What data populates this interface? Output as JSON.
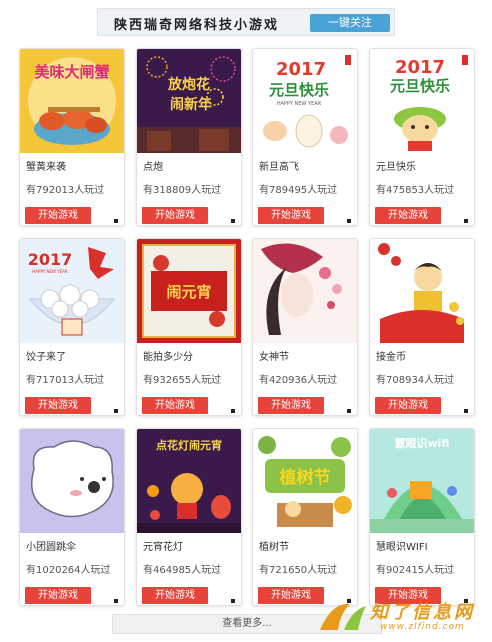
{
  "header": {
    "title": "陕西瑞奇网络科技小游戏",
    "follow_label": "一键关注"
  },
  "games": [
    {
      "name": "蟹黄来袭",
      "plays": "有792013人玩过",
      "start_label": "开始游戏",
      "thumb": "crab"
    },
    {
      "name": "点炮",
      "plays": "有318809人玩过",
      "start_label": "开始游戏",
      "thumb": "firecracker"
    },
    {
      "name": "新旦高飞",
      "plays": "有789495人玩过",
      "start_label": "开始游戏",
      "thumb": "newyear-egg"
    },
    {
      "name": "元旦快乐",
      "plays": "有475853人玩过",
      "start_label": "开始游戏",
      "thumb": "newyear-character"
    },
    {
      "name": "饺子来了",
      "plays": "有717013人玩过",
      "start_label": "开始游戏",
      "thumb": "dumplings"
    },
    {
      "name": "能拍多少分",
      "plays": "有932655人玩过",
      "start_label": "开始游戏",
      "thumb": "red-festival"
    },
    {
      "name": "女神节",
      "plays": "有420936人玩过",
      "start_label": "开始游戏",
      "thumb": "goddess"
    },
    {
      "name": "接金币",
      "plays": "有708934人玩过",
      "start_label": "开始游戏",
      "thumb": "coins"
    },
    {
      "name": "小团圆跳伞",
      "plays": "有1020264人玩过",
      "start_label": "开始游戏",
      "thumb": "bear"
    },
    {
      "name": "元宵花灯",
      "plays": "有464985人玩过",
      "start_label": "开始游戏",
      "thumb": "lantern"
    },
    {
      "name": "植树节",
      "plays": "有721650人玩过",
      "start_label": "开始游戏",
      "thumb": "tree"
    },
    {
      "name": "慧眼识WIFI",
      "plays": "有902415人玩过",
      "start_label": "开始游戏",
      "thumb": "wifi"
    }
  ],
  "thumb_text": {
    "crab": "美味大闸蟹",
    "firecracker": [
      "放炮花",
      "闹新年"
    ],
    "newyear_year": "2017",
    "newyear_text": "元旦快乐",
    "newyear_sub": "HAPPY NEW YEAR",
    "red_festival": "闹元宵",
    "lantern": "点花灯闹元宵",
    "tree": "植树节",
    "wifi": "慧眼识wifi"
  },
  "load_more_label": "查看更多...",
  "watermark": {
    "brand": "知了信息网",
    "url": "www.zlfind.com"
  },
  "colors": {
    "start_button": "#e8433a",
    "follow_button": "#4aa3d6"
  }
}
